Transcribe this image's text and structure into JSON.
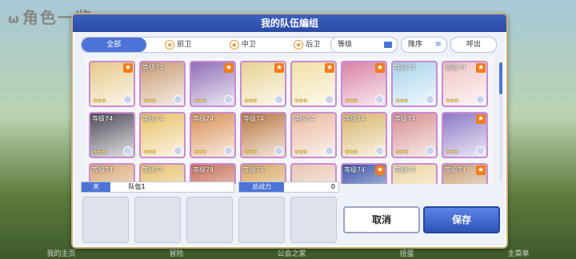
{
  "background": {
    "title": "角色一览",
    "bottom_tabs": [
      "我的主页",
      "冒险",
      "公会之家",
      "扭蛋",
      "主菜单"
    ]
  },
  "dialog": {
    "title": "我的队伍编组",
    "tabs": [
      "全部",
      "前卫",
      "中卫",
      "后卫"
    ],
    "sort_label": "等级",
    "order_label": "降序",
    "call_label": "呼出"
  },
  "grid": {
    "cards": [
      {
        "level": "",
        "stars": 3,
        "badge": true,
        "color": "#e7c98a"
      },
      {
        "level": "等级74",
        "stars": 3,
        "badge": false,
        "color": "#c99a72"
      },
      {
        "level": "",
        "stars": 3,
        "badge": true,
        "color": "#8e6fb8"
      },
      {
        "level": "",
        "stars": 3,
        "badge": true,
        "color": "#e8d293"
      },
      {
        "level": "",
        "stars": 3,
        "badge": true,
        "color": "#f1dfa6"
      },
      {
        "level": "",
        "stars": 3,
        "badge": true,
        "color": "#d981a6"
      },
      {
        "level": "等级74",
        "stars": 3,
        "badge": false,
        "color": "#a9d4ec"
      },
      {
        "level": "等级74",
        "stars": 3,
        "badge": true,
        "color": "#f0c4c4"
      },
      {
        "level": "等级74",
        "stars": 3,
        "badge": false,
        "color": "#4d4a58"
      },
      {
        "level": "等级74",
        "stars": 3,
        "badge": false,
        "color": "#e9c168"
      },
      {
        "level": "等级74",
        "stars": 3,
        "badge": false,
        "color": "#d98f55"
      },
      {
        "level": "等级74",
        "stars": 3,
        "badge": false,
        "color": "#b8763f"
      },
      {
        "level": "等级74",
        "stars": 3,
        "badge": false,
        "color": "#eab89b"
      },
      {
        "level": "等级74",
        "stars": 3,
        "badge": false,
        "color": "#d9b56b"
      },
      {
        "level": "等级74",
        "stars": 3,
        "badge": false,
        "color": "#d58c8c"
      },
      {
        "level": "",
        "stars": 3,
        "badge": true,
        "color": "#8d79c6"
      },
      {
        "level": "等级74",
        "stars": 3,
        "badge": false,
        "color": "#d9a877"
      },
      {
        "level": "等级74",
        "stars": 3,
        "badge": false,
        "color": "#e6c06b"
      },
      {
        "level": "等级74",
        "stars": 3,
        "badge": false,
        "color": "#c56f5a"
      },
      {
        "level": "等级74",
        "stars": 3,
        "badge": false,
        "color": "#d6a65f"
      },
      {
        "level": "",
        "stars": 3,
        "badge": false,
        "color": "#e9c7b5"
      },
      {
        "level": "等级74",
        "stars": 3,
        "badge": true,
        "color": "#3e56a8"
      },
      {
        "level": "等级74",
        "stars": 3,
        "badge": false,
        "color": "#ead6a1"
      },
      {
        "level": "等级74",
        "stars": 3,
        "badge": true,
        "color": "#caa07a"
      }
    ]
  },
  "team": {
    "rank_icon": "末",
    "name": "队伍1",
    "power_label": "总战力",
    "power_value": "0"
  },
  "buttons": {
    "cancel": "取消",
    "save": "保存"
  }
}
